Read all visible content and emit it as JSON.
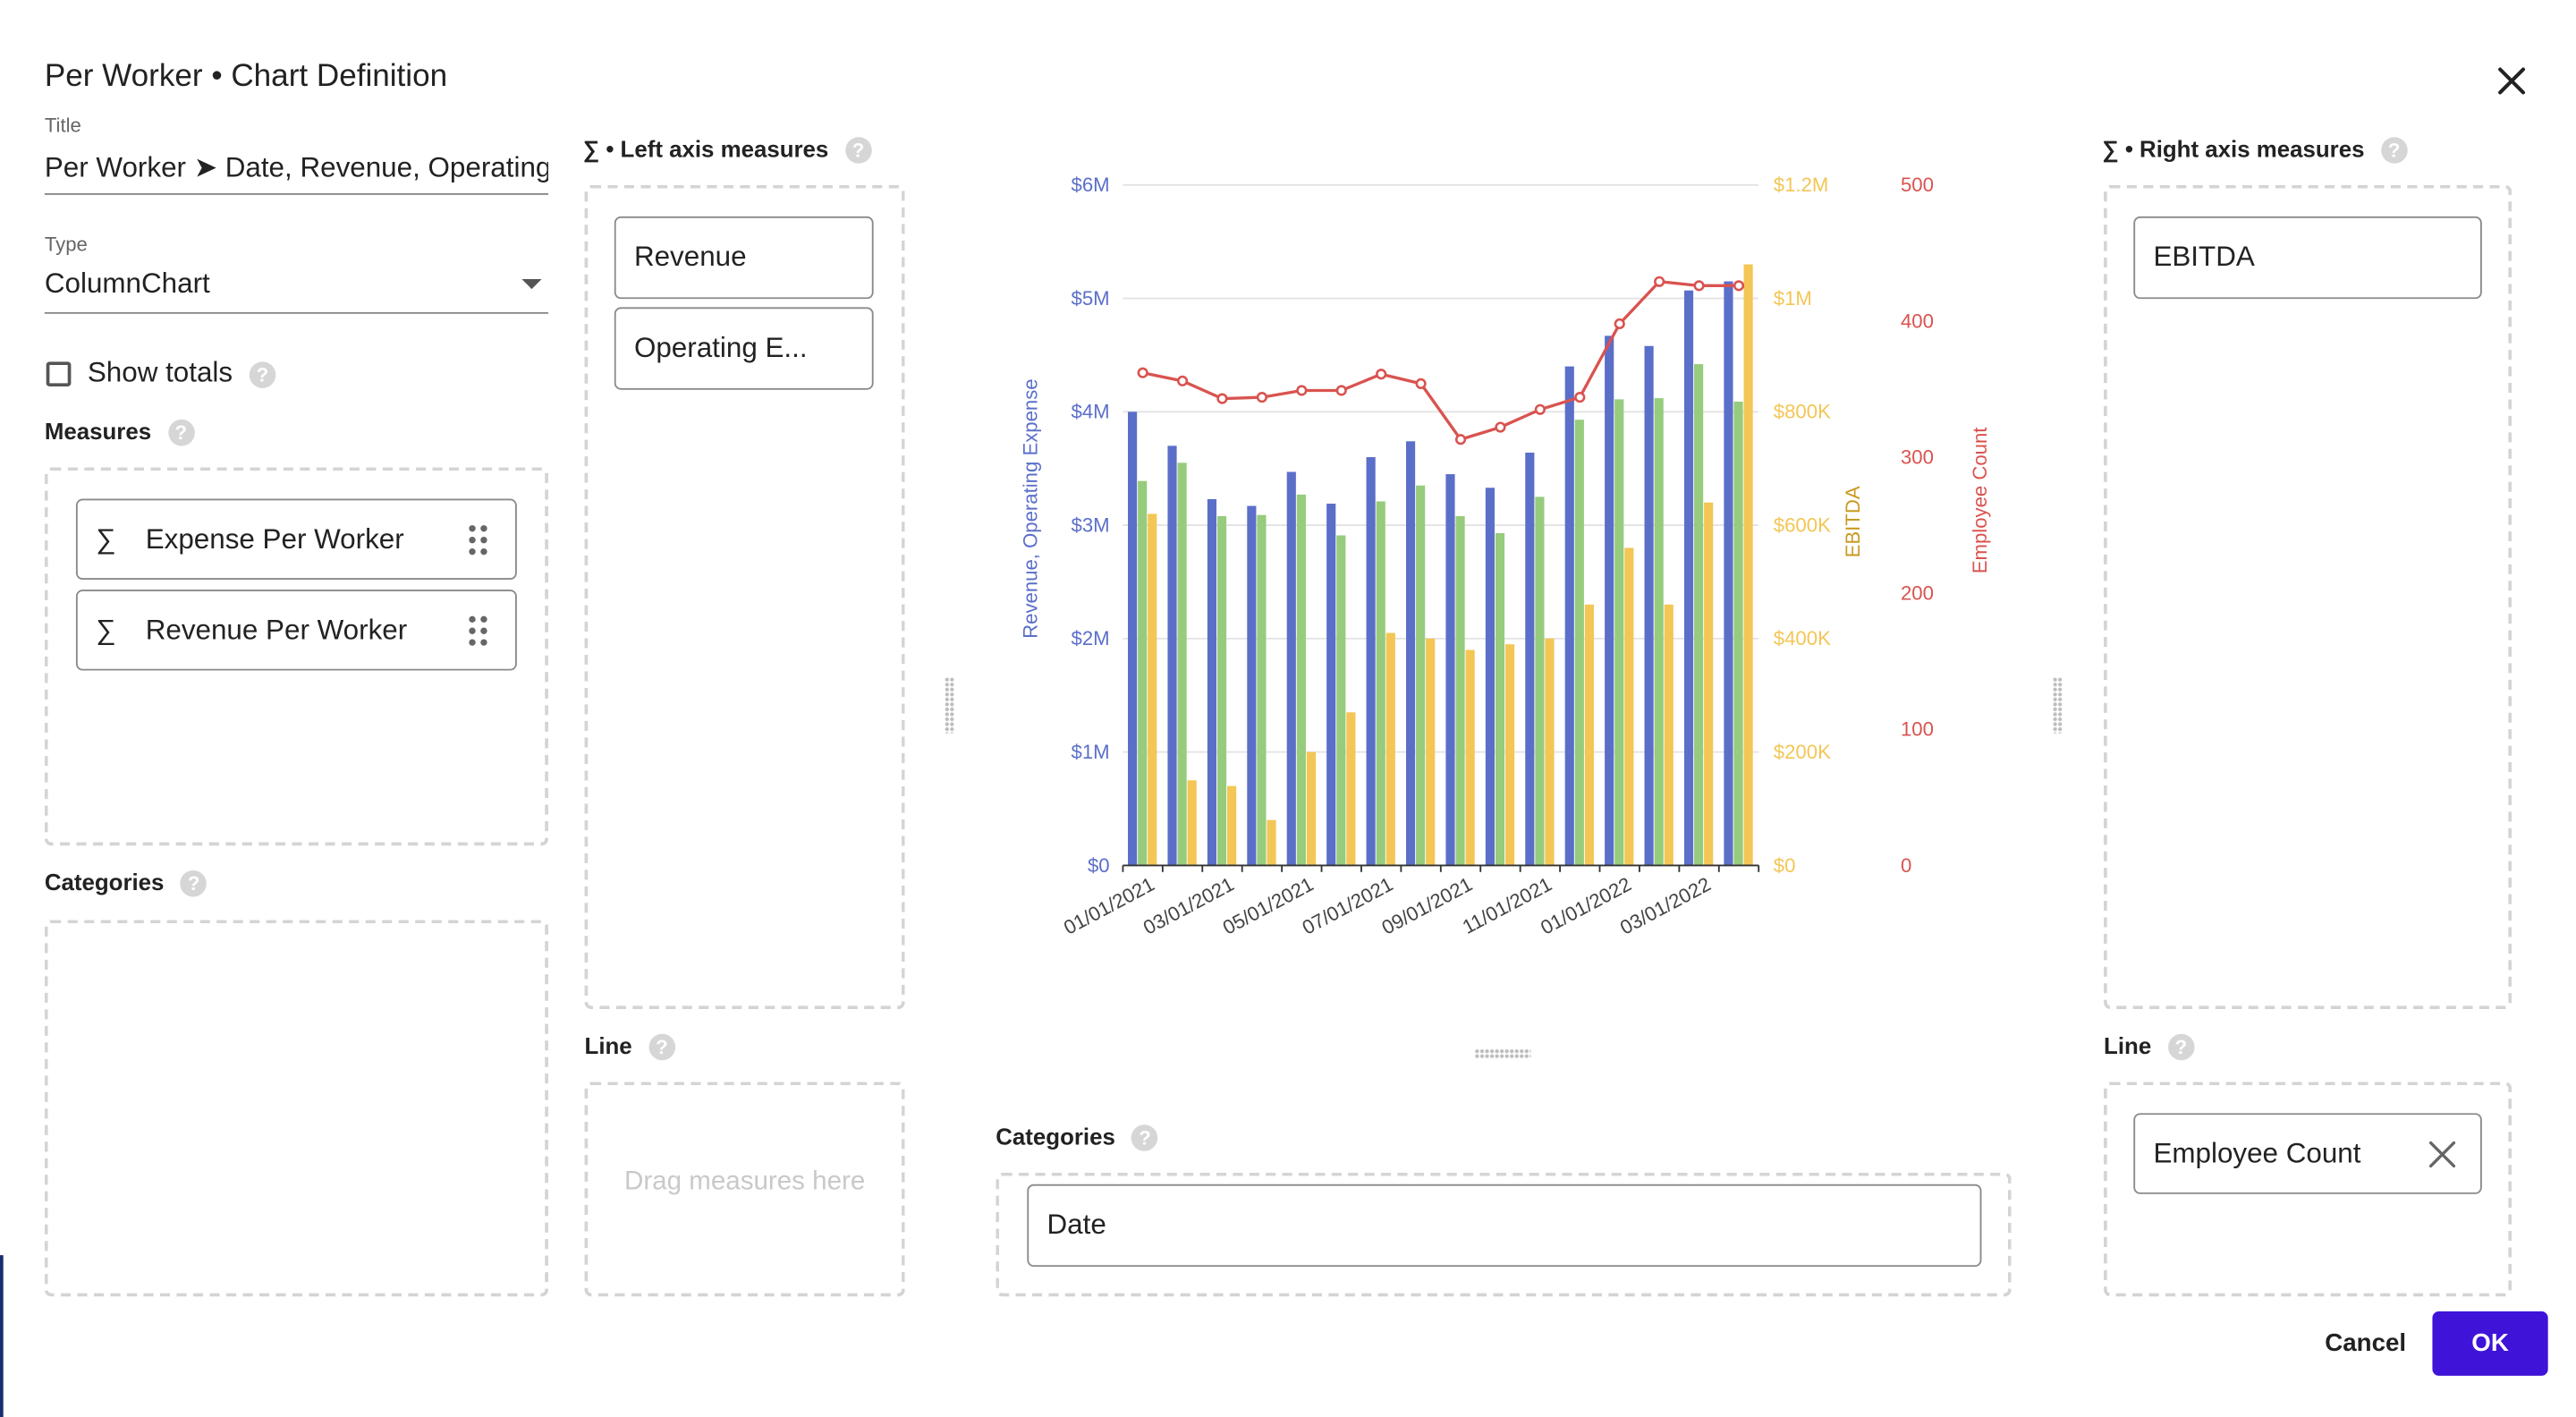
{
  "dialog": {
    "title": "Per Worker • Chart Definition"
  },
  "title_field": {
    "label": "Title",
    "value": "Per Worker ➤ Date, Revenue, Operating"
  },
  "type_field": {
    "label": "Type",
    "value": "ColumnChart"
  },
  "show_totals": {
    "label": "Show totals",
    "checked": false
  },
  "measures": {
    "heading": "Measures",
    "items": [
      {
        "label": "Expense Per Worker",
        "icon": "sigma"
      },
      {
        "label": "Revenue Per Worker",
        "icon": "sigma"
      }
    ]
  },
  "categories_left": {
    "heading": "Categories"
  },
  "left_axis": {
    "heading": "∑ • Left axis measures",
    "items": [
      {
        "label": "Revenue"
      },
      {
        "label": "Operating E..."
      }
    ]
  },
  "left_line": {
    "heading": "Line",
    "placeholder": "Drag measures here"
  },
  "right_axis": {
    "heading": "∑ • Right axis measures",
    "items": [
      {
        "label": "EBITDA"
      }
    ]
  },
  "right_line": {
    "heading": "Line",
    "items": [
      {
        "label": "Employee Count"
      }
    ]
  },
  "categories_center": {
    "heading": "Categories",
    "items": [
      {
        "label": "Date"
      }
    ]
  },
  "buttons": {
    "cancel": "Cancel",
    "ok": "OK"
  },
  "colors": {
    "revenue": "#5b6fc9",
    "operating_expense": "#96cc7c",
    "ebitda": "#f3c655",
    "employee_count": "#d9534f",
    "ok_button": "#3f13d8"
  },
  "chart_data": {
    "type": "bar",
    "x_tick_labels": [
      "01/01/2021",
      "03/01/2021",
      "05/01/2021",
      "07/01/2021",
      "09/01/2021",
      "11/01/2021",
      "01/01/2022",
      "03/01/2022"
    ],
    "categories": [
      "01/01/2021",
      "02/01/2021",
      "03/01/2021",
      "04/01/2021",
      "05/01/2021",
      "06/01/2021",
      "07/01/2021",
      "08/01/2021",
      "09/01/2021",
      "10/01/2021",
      "11/01/2021",
      "12/01/2021",
      "01/01/2022",
      "02/01/2022",
      "03/01/2022",
      "04/01/2022"
    ],
    "left_axis": {
      "label": "Revenue, Operating Expense",
      "ticks": [
        "$0",
        "$1M",
        "$2M",
        "$3M",
        "$4M",
        "$5M",
        "$6M"
      ],
      "ylim": [
        0,
        6000000
      ]
    },
    "ebitda_axis": {
      "label": "EBITDA",
      "ticks": [
        "$0",
        "$200K",
        "$400K",
        "$600K",
        "$800K",
        "$1M",
        "$1.2M"
      ],
      "ylim": [
        0,
        1200000
      ]
    },
    "employee_axis": {
      "label": "Employee Count",
      "ticks": [
        "0",
        "100",
        "200",
        "300",
        "400",
        "500"
      ],
      "ylim": [
        0,
        500
      ]
    },
    "series": [
      {
        "name": "Revenue",
        "axis": "left",
        "kind": "bar",
        "values": [
          4000000,
          3700000,
          3230000,
          3170000,
          3470000,
          3190000,
          3600000,
          3740000,
          3450000,
          3330000,
          3640000,
          4400000,
          4670000,
          4580000,
          5070000,
          5150000
        ]
      },
      {
        "name": "Operating Expense",
        "axis": "left",
        "kind": "bar",
        "values": [
          3390000,
          3550000,
          3080000,
          3090000,
          3270000,
          2910000,
          3210000,
          3350000,
          3080000,
          2930000,
          3250000,
          3930000,
          4110000,
          4120000,
          4420000,
          4090000
        ]
      },
      {
        "name": "EBITDA",
        "axis": "ebitda",
        "kind": "bar",
        "values": [
          620000,
          150000,
          140000,
          80000,
          200000,
          270000,
          410000,
          400000,
          380000,
          390000,
          400000,
          460000,
          560000,
          460000,
          640000,
          1060000
        ]
      },
      {
        "name": "Employee Count",
        "axis": "employee",
        "kind": "line",
        "values": [
          362,
          356,
          343,
          344,
          349,
          349,
          361,
          354,
          313,
          322,
          335,
          344,
          398,
          429,
          426,
          426
        ]
      }
    ]
  }
}
